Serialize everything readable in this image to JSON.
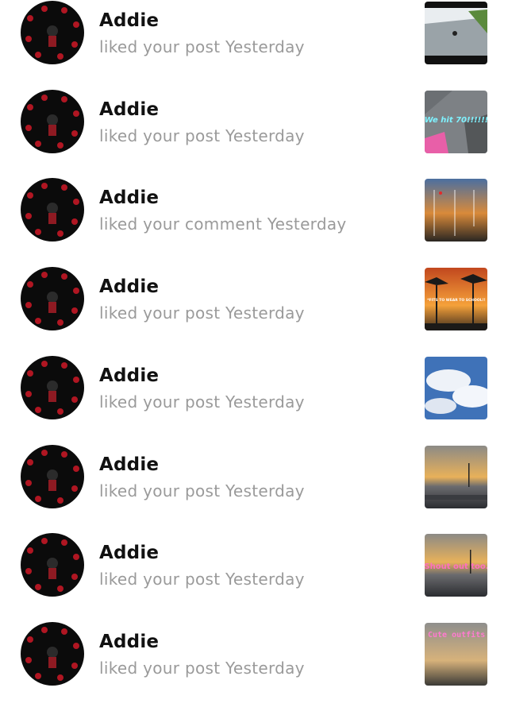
{
  "notifications": [
    {
      "user": "Addie",
      "message": "liked your post Yesterday",
      "thumbnail_icon": "road-photo",
      "thumbnail_text": ""
    },
    {
      "user": "Addie",
      "message": "liked your post Yesterday",
      "thumbnail_icon": "skating-photo",
      "thumbnail_text": "We hit 70!!!!!!"
    },
    {
      "user": "Addie",
      "message": "liked your comment Yesterday",
      "thumbnail_icon": "alphabet-sunset-photo",
      "thumbnail_text": ""
    },
    {
      "user": "Addie",
      "message": "liked your post Yesterday",
      "thumbnail_icon": "palm-sunset-photo",
      "thumbnail_text": "*FITS TO WEAR TO SCHOOL!!"
    },
    {
      "user": "Addie",
      "message": "liked your post Yesterday",
      "thumbnail_icon": "sky-clouds-photo",
      "thumbnail_text": ""
    },
    {
      "user": "Addie",
      "message": "liked your post Yesterday",
      "thumbnail_icon": "parking-sunset-photo",
      "thumbnail_text": ""
    },
    {
      "user": "Addie",
      "message": "liked your post Yesterday",
      "thumbnail_icon": "parking-sunset-photo",
      "thumbnail_text": "Shout out too."
    },
    {
      "user": "Addie",
      "message": "liked your post Yesterday",
      "thumbnail_icon": "outfits-photo",
      "thumbnail_text": "Cute outfits For SCHOOL!!"
    }
  ],
  "colors": {
    "name": "#111111",
    "message": "#9a9a9a",
    "avatar_bg": "#0b0b0b",
    "avatar_pattern": "#b01622"
  }
}
